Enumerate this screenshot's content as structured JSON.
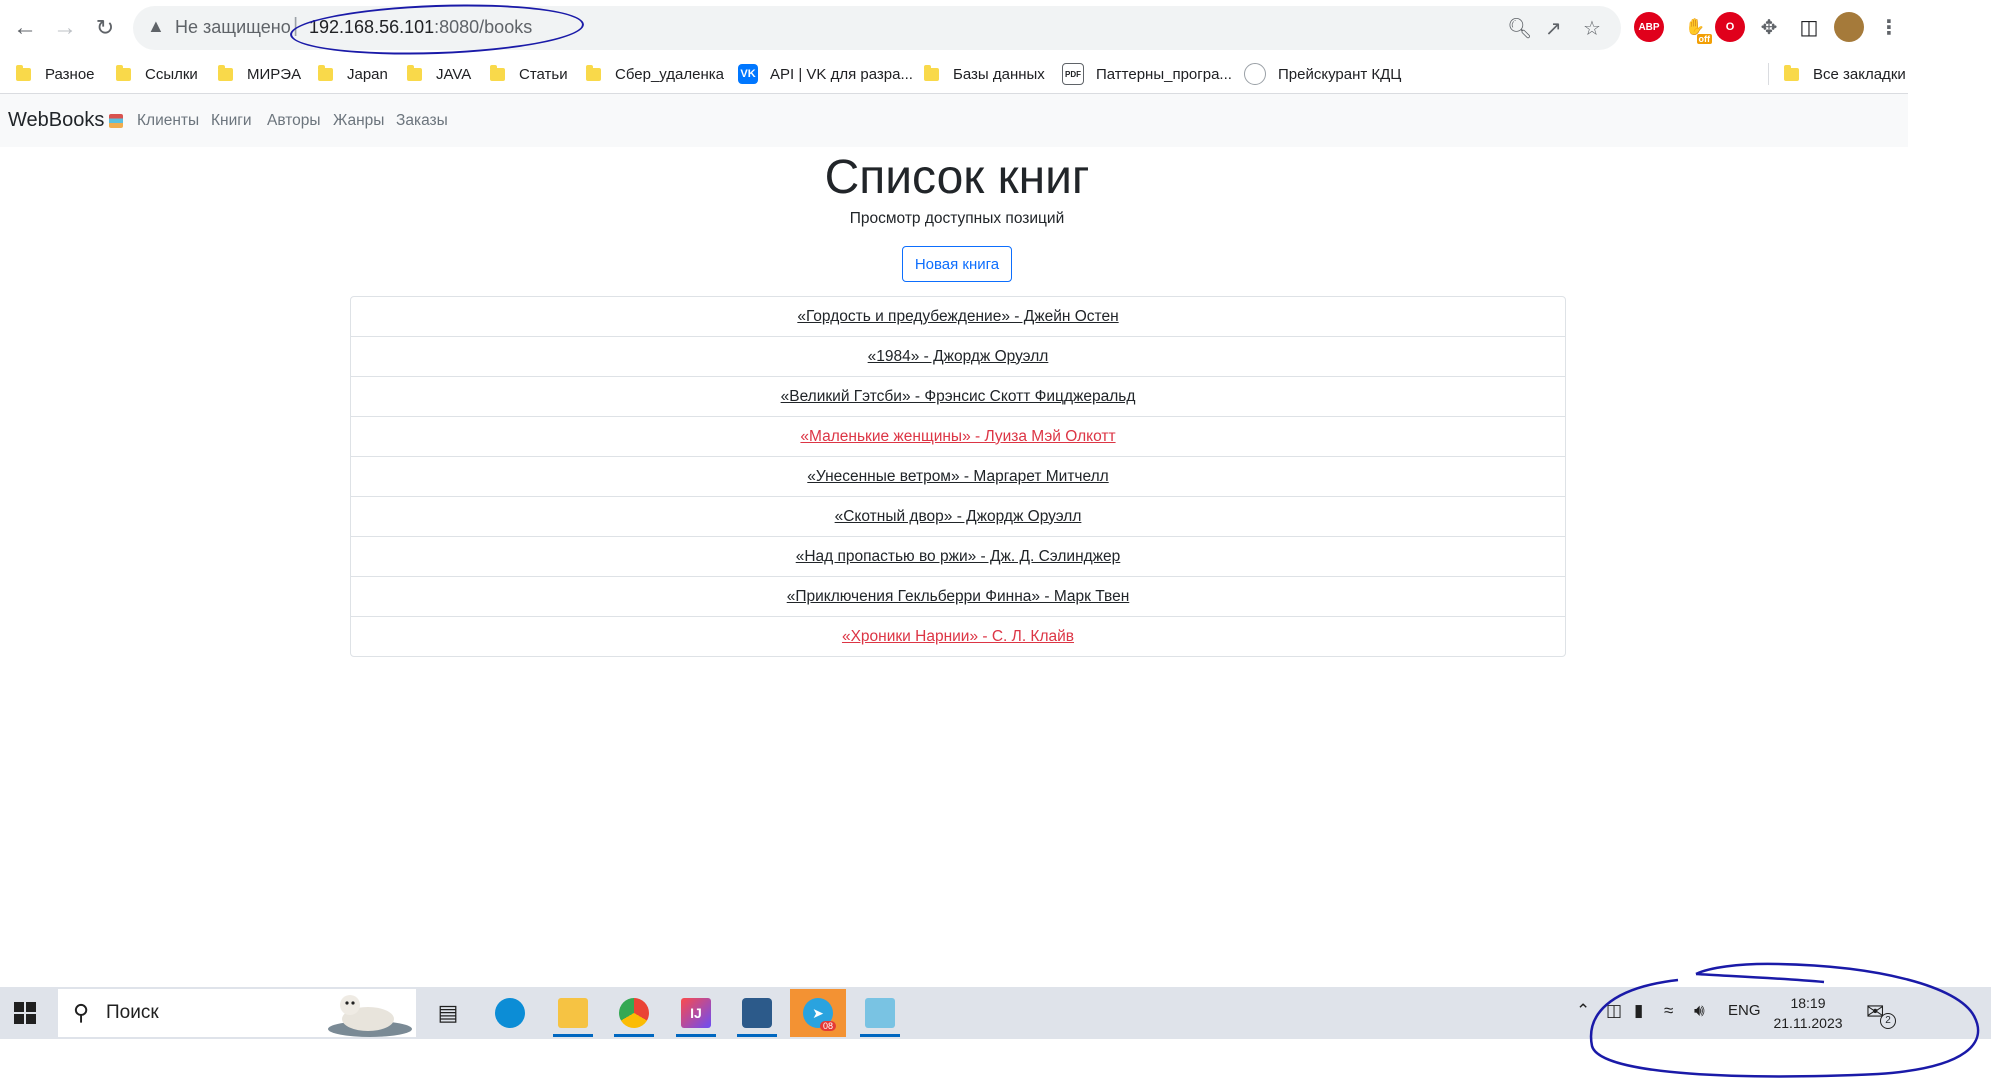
{
  "browser": {
    "nav_icons": {
      "back": "arrow-left-icon",
      "forward": "arrow-right-icon",
      "reload": "reload-icon"
    },
    "security_label": "Не защищено",
    "url_host": "192.168.56.101",
    "url_path": ":8080/books",
    "omnibox_icons": [
      "zoom-icon",
      "share-icon",
      "star-icon"
    ],
    "extensions": [
      {
        "name": "adblock-plus-icon",
        "text": "ABP",
        "color": "#e0001b"
      },
      {
        "name": "ext-off-icon",
        "text": "off",
        "color": "#f29f05"
      },
      {
        "name": "opera-vpn-icon",
        "text": "",
        "color": "#e0001b"
      },
      {
        "name": "puzzle-icon",
        "text": "",
        "color": "#5f6368"
      }
    ],
    "bookmarks": [
      {
        "label": "Разное",
        "icon": "folder-icon"
      },
      {
        "label": "Ссылки",
        "icon": "folder-icon"
      },
      {
        "label": "МИРЭА",
        "icon": "folder-icon"
      },
      {
        "label": "Japan",
        "icon": "folder-icon"
      },
      {
        "label": "JAVA",
        "icon": "folder-icon"
      },
      {
        "label": "Статьи",
        "icon": "folder-icon"
      },
      {
        "label": "Сбер_удаленка",
        "icon": "folder-icon"
      },
      {
        "label": "API | VK для разра...",
        "icon": "vk-icon"
      },
      {
        "label": "Базы данных",
        "icon": "folder-icon"
      },
      {
        "label": "Паттерны_програ...",
        "icon": "pdf-icon"
      },
      {
        "label": "Прейскурант КДЦ",
        "icon": "globe-icon"
      }
    ],
    "all_bookmarks": "Все закладки"
  },
  "site": {
    "brand": "WebBooks",
    "nav": [
      "Клиенты",
      "Книги",
      "Авторы",
      "Жанры",
      "Заказы"
    ],
    "title": "Список книг",
    "subtitle": "Просмотр доступных позиций",
    "new_button": "Новая книга",
    "books": [
      {
        "text": "«Гордость и предубеждение» - Джейн Остен",
        "status": "normal"
      },
      {
        "text": "«1984» - Джордж Оруэлл",
        "status": "normal"
      },
      {
        "text": "«Великий Гэтсби» - Фрэнсис Скотт Фицджеральд",
        "status": "normal"
      },
      {
        "text": "«Маленькие женщины» - Луиза Мэй Олкотт",
        "status": "red"
      },
      {
        "text": "«Унесенные ветром» - Маргарет Митчелл",
        "status": "normal"
      },
      {
        "text": "«Скотный двор» - Джордж Оруэлл",
        "status": "normal"
      },
      {
        "text": "«Над пропастью во ржи» - Дж. Д. Сэлинджер",
        "status": "normal"
      },
      {
        "text": "«Приключения Гекльберри Финна» - Марк Твен",
        "status": "normal"
      },
      {
        "text": "«Хроники Нарнии» - С. Л. Клайв",
        "status": "red"
      }
    ],
    "colors": {
      "link": "#212529",
      "red_link": "#dc3545",
      "primary": "#0d6efd"
    }
  },
  "taskbar": {
    "search_placeholder": "Поиск",
    "apps": [
      {
        "name": "task-view-icon",
        "label": ""
      },
      {
        "name": "edge-icon",
        "label": ""
      },
      {
        "name": "file-explorer-icon",
        "label": ""
      },
      {
        "name": "chrome-icon",
        "label": ""
      },
      {
        "name": "intellij-icon",
        "label": ""
      },
      {
        "name": "virtualbox-icon",
        "label": ""
      },
      {
        "name": "telegram-icon",
        "label": "08"
      },
      {
        "name": "notepad-icon",
        "label": ""
      }
    ],
    "language": "ENG",
    "time": "18:19",
    "date": "21.11.2023",
    "notification_count": "2"
  }
}
